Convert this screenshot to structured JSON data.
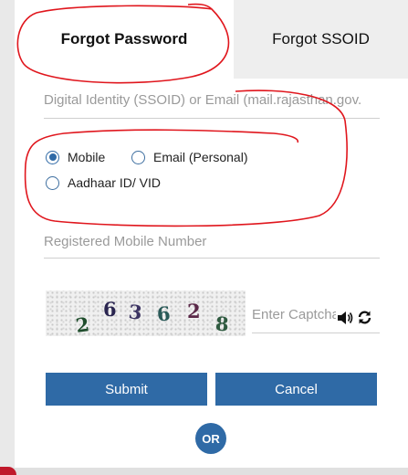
{
  "tabs": {
    "forgot_password": "Forgot Password",
    "forgot_ssoid": "Forgot SSOID"
  },
  "form": {
    "ssoid_placeholder": "Digital Identity (SSOID) or Email (mail.rajasthan.gov.",
    "radio_options": {
      "mobile": "Mobile",
      "email": "Email (Personal)",
      "aadhaar": "Aadhaar ID/ VID"
    },
    "selected_option": "Mobile",
    "mobile_placeholder": "Registered Mobile Number",
    "captcha_placeholder": "Enter Captcha",
    "captcha_digits": [
      "2",
      "6",
      "3",
      "6",
      "2",
      "8"
    ]
  },
  "buttons": {
    "submit": "Submit",
    "cancel": "Cancel",
    "or": "OR"
  },
  "icons": {
    "speaker": "speaker-icon",
    "refresh": "refresh-icon"
  },
  "colors": {
    "primary": "#2f6aa6",
    "annotation": "#e0161d"
  }
}
